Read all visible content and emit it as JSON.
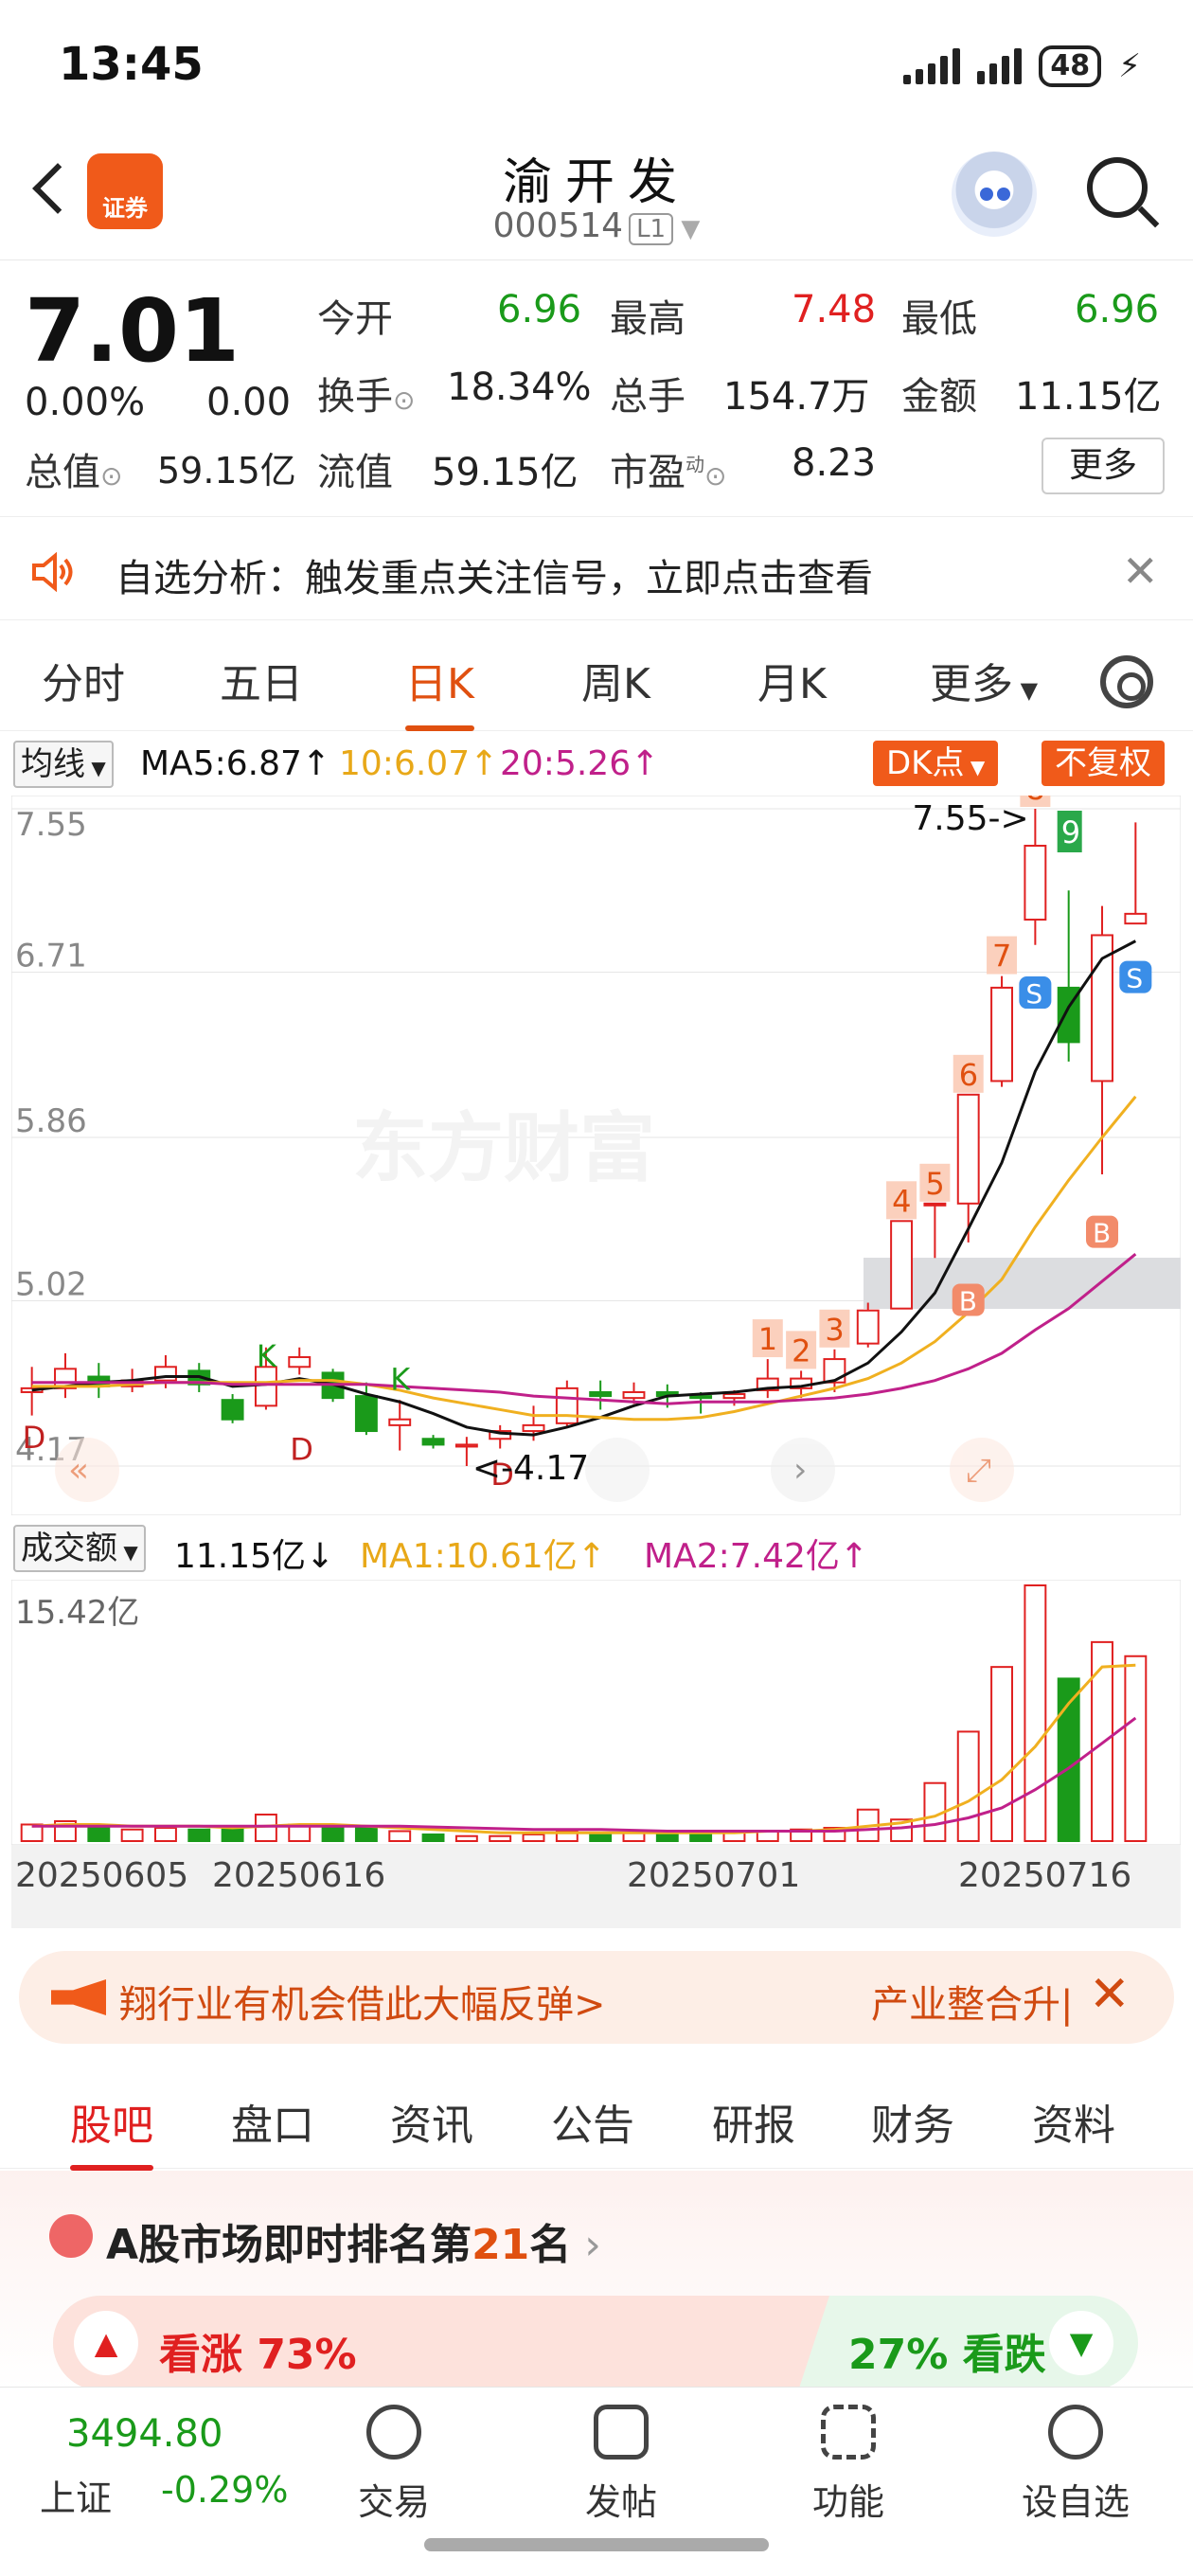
{
  "status_bar": {
    "time": "13:45",
    "battery": "48"
  },
  "header": {
    "logo_text": "证券",
    "stock_name": "渝开发",
    "stock_code": "000514",
    "level": "L1"
  },
  "quote": {
    "price": "7.01",
    "change_pct": "0.00%",
    "change": "0.00",
    "open_label": "今开",
    "open": "6.96",
    "high_label": "最高",
    "high": "7.48",
    "low_label": "最低",
    "low": "6.96",
    "turnover_label": "换手",
    "turnover": "18.34%",
    "volume_label": "总手",
    "volume": "154.7万",
    "amount_label": "金额",
    "amount": "11.15亿",
    "mktcap_label": "总值",
    "mktcap": "59.15亿",
    "float_label": "流值",
    "float": "59.15亿",
    "pe_label": "市盈",
    "pe_sup": "动",
    "pe": "8.23",
    "more_label": "更多"
  },
  "notice": {
    "text": "自选分析：触发重点关注信号，立即点击查看"
  },
  "chart_tabs": [
    "分时",
    "五日",
    "日K",
    "周K",
    "月K",
    "更多"
  ],
  "ma_row": {
    "selector": "均线",
    "ma5": "MA5:6.87↑",
    "ma10": "10:6.07↑",
    "ma20": "20:5.26↑",
    "dk_button": "DK点",
    "adj_button": "不复权"
  },
  "volume_row": {
    "selector": "成交额",
    "amount": "11.15亿↓",
    "ma1": "MA1:10.61亿↑",
    "ma2": "MA2:7.42亿↑"
  },
  "colors": {
    "up": "#e02020",
    "down": "#1a9a1a",
    "ma5": "#111111",
    "ma10": "#f0b020",
    "ma20": "#c0208a",
    "accent": "#f05a1a"
  },
  "chart_data": {
    "type": "candlestick",
    "price_axis": {
      "ylim": [
        4.17,
        7.55
      ],
      "ticks": [
        "7.55",
        "6.71",
        "5.86",
        "5.02",
        "4.17"
      ]
    },
    "volume_axis": {
      "max_label": "15.42亿",
      "max": 15.42
    },
    "date_labels": [
      "20250605",
      "20250616",
      "20250701",
      "20250716"
    ],
    "annotations": {
      "high_marker": "7.55->",
      "low_marker": "<-4.17"
    },
    "candles": [
      {
        "o": 4.55,
        "c": 4.57,
        "h": 4.68,
        "l": 4.43,
        "v": 1.0
      },
      {
        "o": 4.57,
        "c": 4.67,
        "h": 4.75,
        "l": 4.52,
        "v": 1.2
      },
      {
        "o": 4.63,
        "c": 4.58,
        "h": 4.7,
        "l": 4.52,
        "v": 0.9
      },
      {
        "o": 4.58,
        "c": 4.61,
        "h": 4.67,
        "l": 4.55,
        "v": 0.7
      },
      {
        "o": 4.61,
        "c": 4.68,
        "h": 4.74,
        "l": 4.57,
        "v": 0.8
      },
      {
        "o": 4.66,
        "c": 4.59,
        "h": 4.7,
        "l": 4.55,
        "v": 0.7
      },
      {
        "o": 4.51,
        "c": 4.41,
        "h": 4.54,
        "l": 4.39,
        "v": 0.7
      },
      {
        "o": 4.48,
        "c": 4.68,
        "h": 4.78,
        "l": 4.46,
        "v": 1.6
      },
      {
        "o": 4.68,
        "c": 4.73,
        "h": 4.78,
        "l": 4.64,
        "v": 1.0
      },
      {
        "o": 4.65,
        "c": 4.52,
        "h": 4.67,
        "l": 4.5,
        "v": 0.9
      },
      {
        "o": 4.53,
        "c": 4.35,
        "h": 4.6,
        "l": 4.33,
        "v": 0.8
      },
      {
        "o": 4.38,
        "c": 4.41,
        "h": 4.51,
        "l": 4.25,
        "v": 0.6
      },
      {
        "o": 4.31,
        "c": 4.28,
        "h": 4.33,
        "l": 4.26,
        "v": 0.4
      },
      {
        "o": 4.27,
        "c": 4.28,
        "h": 4.32,
        "l": 4.17,
        "v": 0.3
      },
      {
        "o": 4.31,
        "c": 4.35,
        "h": 4.38,
        "l": 4.26,
        "v": 0.3
      },
      {
        "o": 4.35,
        "c": 4.38,
        "h": 4.48,
        "l": 4.3,
        "v": 0.4
      },
      {
        "o": 4.39,
        "c": 4.57,
        "h": 4.61,
        "l": 4.37,
        "v": 0.6
      },
      {
        "o": 4.55,
        "c": 4.53,
        "h": 4.61,
        "l": 4.46,
        "v": 0.5
      },
      {
        "o": 4.52,
        "c": 4.55,
        "h": 4.6,
        "l": 4.49,
        "v": 0.5
      },
      {
        "o": 4.55,
        "c": 4.53,
        "h": 4.59,
        "l": 4.47,
        "v": 0.5
      },
      {
        "o": 4.53,
        "c": 4.52,
        "h": 4.55,
        "l": 4.44,
        "v": 0.5
      },
      {
        "o": 4.52,
        "c": 4.54,
        "h": 4.56,
        "l": 4.48,
        "v": 0.6
      },
      {
        "o": 4.56,
        "c": 4.62,
        "h": 4.72,
        "l": 4.52,
        "v": 0.6
      },
      {
        "o": 4.57,
        "c": 4.62,
        "h": 4.66,
        "l": 4.52,
        "v": 0.7
      },
      {
        "o": 4.6,
        "c": 4.72,
        "h": 4.77,
        "l": 4.55,
        "v": 0.8
      },
      {
        "o": 4.8,
        "c": 4.97,
        "h": 5.01,
        "l": 4.78,
        "v": 1.9
      },
      {
        "o": 4.98,
        "c": 5.43,
        "h": 5.43,
        "l": 4.98,
        "v": 1.3
      },
      {
        "o": 5.52,
        "c": 5.52,
        "h": 5.52,
        "l": 5.24,
        "v": 3.5
      },
      {
        "o": 5.52,
        "c": 6.08,
        "h": 6.08,
        "l": 5.32,
        "v": 6.6
      },
      {
        "o": 6.15,
        "c": 6.63,
        "h": 6.69,
        "l": 6.12,
        "v": 10.5
      },
      {
        "o": 6.98,
        "c": 7.36,
        "h": 7.55,
        "l": 6.85,
        "v": 15.42
      },
      {
        "o": 6.63,
        "c": 6.35,
        "h": 7.13,
        "l": 6.25,
        "v": 9.8
      },
      {
        "o": 6.15,
        "c": 6.9,
        "h": 7.05,
        "l": 5.67,
        "v": 12.0
      },
      {
        "o": 6.96,
        "c": 7.01,
        "h": 7.48,
        "l": 6.96,
        "v": 11.15
      }
    ],
    "ma5": [
      4.56,
      4.58,
      4.6,
      4.61,
      4.63,
      4.63,
      4.58,
      4.59,
      4.62,
      4.59,
      4.54,
      4.5,
      4.44,
      4.37,
      4.34,
      4.33,
      4.37,
      4.42,
      4.48,
      4.53,
      4.54,
      4.55,
      4.57,
      4.58,
      4.61,
      4.7,
      4.86,
      5.06,
      5.39,
      5.73,
      6.2,
      6.53,
      6.78,
      6.87
    ],
    "ma10": [
      4.58,
      4.58,
      4.58,
      4.59,
      4.6,
      4.6,
      4.6,
      4.6,
      4.61,
      4.61,
      4.59,
      4.56,
      4.52,
      4.49,
      4.46,
      4.43,
      4.43,
      4.42,
      4.41,
      4.41,
      4.42,
      4.45,
      4.49,
      4.53,
      4.57,
      4.62,
      4.7,
      4.81,
      4.96,
      5.13,
      5.4,
      5.64,
      5.86,
      6.07
    ],
    "ma20": [
      4.6,
      4.6,
      4.6,
      4.6,
      4.6,
      4.6,
      4.59,
      4.59,
      4.59,
      4.59,
      4.59,
      4.58,
      4.57,
      4.56,
      4.55,
      4.53,
      4.52,
      4.51,
      4.5,
      4.49,
      4.5,
      4.5,
      4.5,
      4.51,
      4.52,
      4.54,
      4.57,
      4.61,
      4.67,
      4.75,
      4.87,
      4.98,
      5.12,
      5.26
    ],
    "amount_ma1": [
      0.9,
      1.0,
      1.0,
      0.9,
      0.9,
      0.9,
      0.8,
      0.9,
      1.0,
      1.0,
      0.9,
      0.8,
      0.7,
      0.6,
      0.5,
      0.5,
      0.5,
      0.5,
      0.5,
      0.5,
      0.5,
      0.5,
      0.6,
      0.6,
      0.7,
      0.9,
      1.1,
      1.5,
      2.4,
      3.7,
      5.7,
      8.3,
      10.5,
      10.61
    ],
    "amount_ma2": [
      0.9,
      0.9,
      0.9,
      0.9,
      0.9,
      0.9,
      0.9,
      0.9,
      0.9,
      0.9,
      0.9,
      0.9,
      0.85,
      0.8,
      0.75,
      0.7,
      0.7,
      0.7,
      0.65,
      0.6,
      0.6,
      0.6,
      0.6,
      0.6,
      0.6,
      0.7,
      0.8,
      1.0,
      1.4,
      2.0,
      3.1,
      4.4,
      5.9,
      7.42
    ]
  },
  "ad": {
    "left_text": "翔行业有机会借此大幅反弹>",
    "right_text": "产业整合升|"
  },
  "detail_tabs": [
    "股吧",
    "盘口",
    "资讯",
    "公告",
    "研报",
    "财务",
    "资料"
  ],
  "ranking": {
    "prefix": "A股市场即时排名第",
    "rank": "21",
    "suffix": "名",
    "up_label": "看涨 73%",
    "down_label": "27% 看跌",
    "up_pct": 73
  },
  "bottom_nav": {
    "index_value": "3494.80",
    "index_name": "上证",
    "index_change": "-0.29%",
    "items": [
      "交易",
      "发帖",
      "功能",
      "设自选"
    ]
  }
}
